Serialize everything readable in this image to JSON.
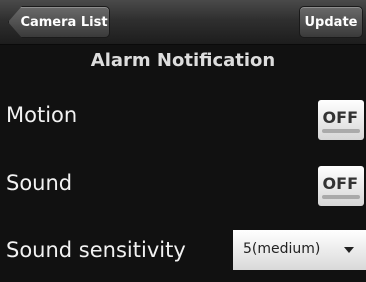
{
  "header": {
    "back_label": "Camera List",
    "update_label": "Update"
  },
  "title": "Alarm Notification",
  "settings": {
    "motion": {
      "label": "Motion",
      "state": "OFF"
    },
    "sound": {
      "label": "Sound",
      "state": "OFF"
    },
    "sensitivity": {
      "label": "Sound sensitivity",
      "value": "5(medium)"
    }
  }
}
